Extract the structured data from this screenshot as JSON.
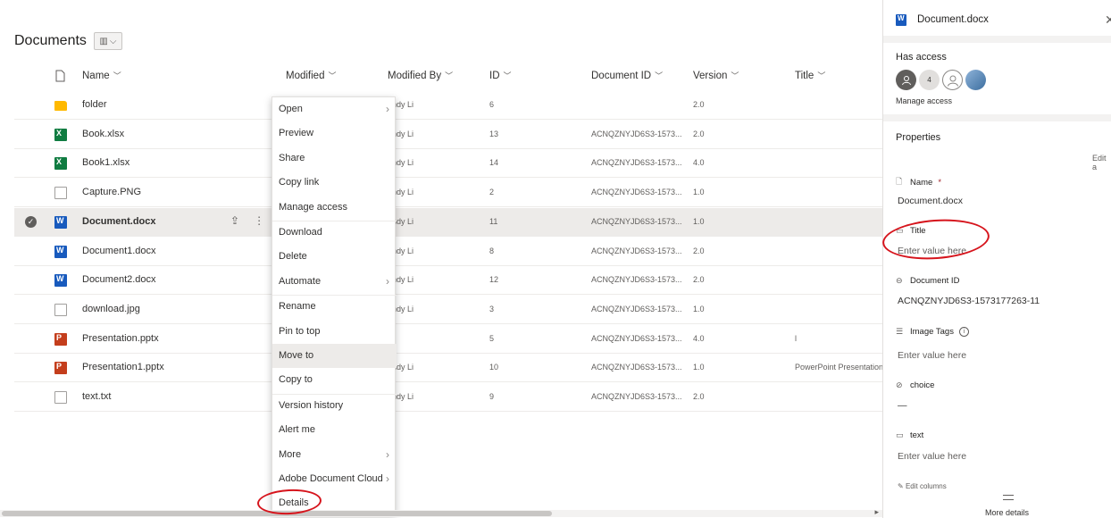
{
  "library": {
    "title": "Documents"
  },
  "columns": [
    "Name",
    "Modified",
    "Modified By",
    "ID",
    "Document ID",
    "Version",
    "Title"
  ],
  "rows": [
    {
      "name": "folder",
      "icon": "folder-icon",
      "type": "folder",
      "modified_by": "endy Li",
      "id": "6",
      "doc_id": "",
      "version": "2.0",
      "title": ""
    },
    {
      "name": "Book.xlsx",
      "icon": "excel-file-icon",
      "type": "xlsx",
      "modified_by": "endy Li",
      "id": "13",
      "doc_id": "ACNQZNYJD6S3-1573...",
      "version": "2.0",
      "title": ""
    },
    {
      "name": "Book1.xlsx",
      "icon": "excel-file-icon",
      "type": "xlsx",
      "modified_by": "endy Li",
      "id": "14",
      "doc_id": "ACNQZNYJD6S3-1573...",
      "version": "4.0",
      "title": ""
    },
    {
      "name": "Capture.PNG",
      "icon": "image-file-icon",
      "type": "img",
      "modified_by": "endy Li",
      "id": "2",
      "doc_id": "ACNQZNYJD6S3-1573...",
      "version": "1.0",
      "title": ""
    },
    {
      "name": "Document.docx",
      "icon": "word-file-icon",
      "type": "docx",
      "modified_by": "endy Li",
      "id": "11",
      "doc_id": "ACNQZNYJD6S3-1573...",
      "version": "1.0",
      "title": "",
      "selected": true
    },
    {
      "name": "Document1.docx",
      "icon": "word-file-icon",
      "type": "docx",
      "modified_by": "endy Li",
      "id": "8",
      "doc_id": "ACNQZNYJD6S3-1573...",
      "version": "2.0",
      "title": ""
    },
    {
      "name": "Document2.docx",
      "icon": "word-file-icon",
      "type": "docx",
      "modified_by": "endy Li",
      "id": "12",
      "doc_id": "ACNQZNYJD6S3-1573...",
      "version": "2.0",
      "title": ""
    },
    {
      "name": "download.jpg",
      "icon": "image-file-icon",
      "type": "img",
      "modified_by": "endy Li",
      "id": "3",
      "doc_id": "ACNQZNYJD6S3-1573...",
      "version": "1.0",
      "title": ""
    },
    {
      "name": "Presentation.pptx",
      "icon": "powerpoint-file-icon",
      "type": "pptx",
      "modified_by": "yi",
      "id": "5",
      "doc_id": "ACNQZNYJD6S3-1573...",
      "version": "4.0",
      "title": "l"
    },
    {
      "name": "Presentation1.pptx",
      "icon": "powerpoint-file-icon",
      "type": "pptx",
      "modified_by": "endy Li",
      "id": "10",
      "doc_id": "ACNQZNYJD6S3-1573...",
      "version": "1.0",
      "title": "PowerPoint Presentation"
    },
    {
      "name": "text.txt",
      "icon": "text-file-icon",
      "type": "txt",
      "modified_by": "endy Li",
      "id": "9",
      "doc_id": "ACNQZNYJD6S3-1573...",
      "version": "2.0",
      "title": ""
    }
  ],
  "context_menu": [
    {
      "label": "Open",
      "submenu": true
    },
    {
      "label": "Preview"
    },
    {
      "label": "Share"
    },
    {
      "label": "Copy link"
    },
    {
      "label": "Manage access"
    },
    {
      "label": "Download"
    },
    {
      "label": "Delete"
    },
    {
      "label": "Automate",
      "submenu": true
    },
    {
      "label": "Rename"
    },
    {
      "label": "Pin to top"
    },
    {
      "label": "Move to",
      "hover": true
    },
    {
      "label": "Copy to"
    },
    {
      "label": "Version history"
    },
    {
      "label": "Alert me"
    },
    {
      "label": "More",
      "submenu": true
    },
    {
      "label": "Adobe Document Cloud",
      "submenu": true
    },
    {
      "label": "Details"
    }
  ],
  "details_pane": {
    "file_name": "Document.docx",
    "has_access": "Has access",
    "avatar_badge": "4",
    "manage_access": "Manage access",
    "properties": "Properties",
    "edit_all": "Edit a",
    "fields": {
      "name_label": "Name",
      "name_required": "*",
      "name_value": "Document.docx",
      "title_label": "Title",
      "title_placeholder": "Enter value here",
      "docid_label": "Document ID",
      "docid_value": "ACNQZNYJD6S3-1573177263-11",
      "tags_label": "Image Tags",
      "tags_placeholder": "Enter value here",
      "choice_label": "choice",
      "choice_value": "—",
      "text_label": "text",
      "text_placeholder": "Enter value here"
    },
    "edit_columns": "Edit columns",
    "more_details": "More details"
  },
  "colors": {
    "annotation": "#d6141c",
    "selected_row": "#edebe9",
    "word": "#185abd",
    "excel": "#107c41",
    "powerpoint": "#c43e1c",
    "folder": "#ffb900"
  }
}
